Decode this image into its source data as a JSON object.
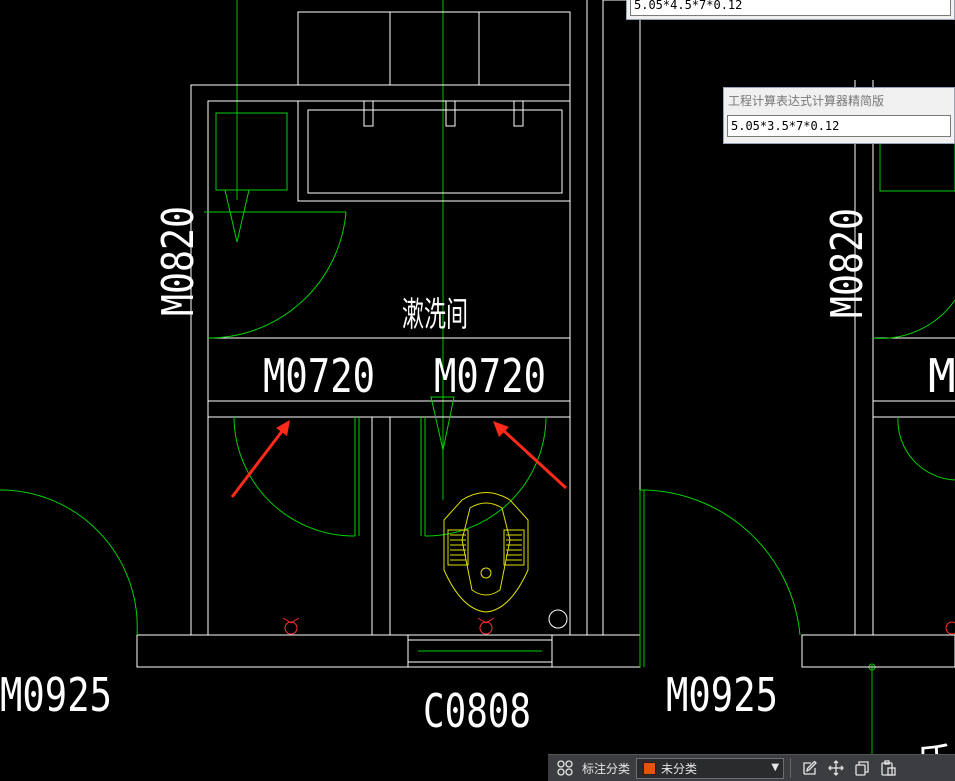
{
  "calculator_windows": [
    {
      "title": "",
      "expression": "5.05*4.5*7*0.12"
    },
    {
      "title": "工程计算表达式计算器精简版",
      "expression": "5.05*3.5*7*0.12"
    }
  ],
  "drawing": {
    "room_label": "漱洗间",
    "door_labels": {
      "left_wall_vertical": "M0820",
      "right_wall_vertical": "M0820",
      "inner_left": "M0720",
      "inner_right": "M0720",
      "right_partial": "M",
      "bottom_left": "M0925",
      "bottom_right": "M0925"
    },
    "window_label": "C0808",
    "corner_partial_text": "氏",
    "colors": {
      "wall": "#ffffff",
      "door_swing": "#00d000",
      "fixture": "#e0e000",
      "marker": "#ff3030",
      "arrow": "#ff2a1a",
      "axis": "#00c000"
    }
  },
  "toolbar": {
    "category_label": "标注分类",
    "category_value": "未分类",
    "category_color": "#e8520c",
    "icons": [
      "grid-apps-icon",
      "edit-icon",
      "move-icon",
      "copy-icon",
      "paste-icon"
    ]
  }
}
